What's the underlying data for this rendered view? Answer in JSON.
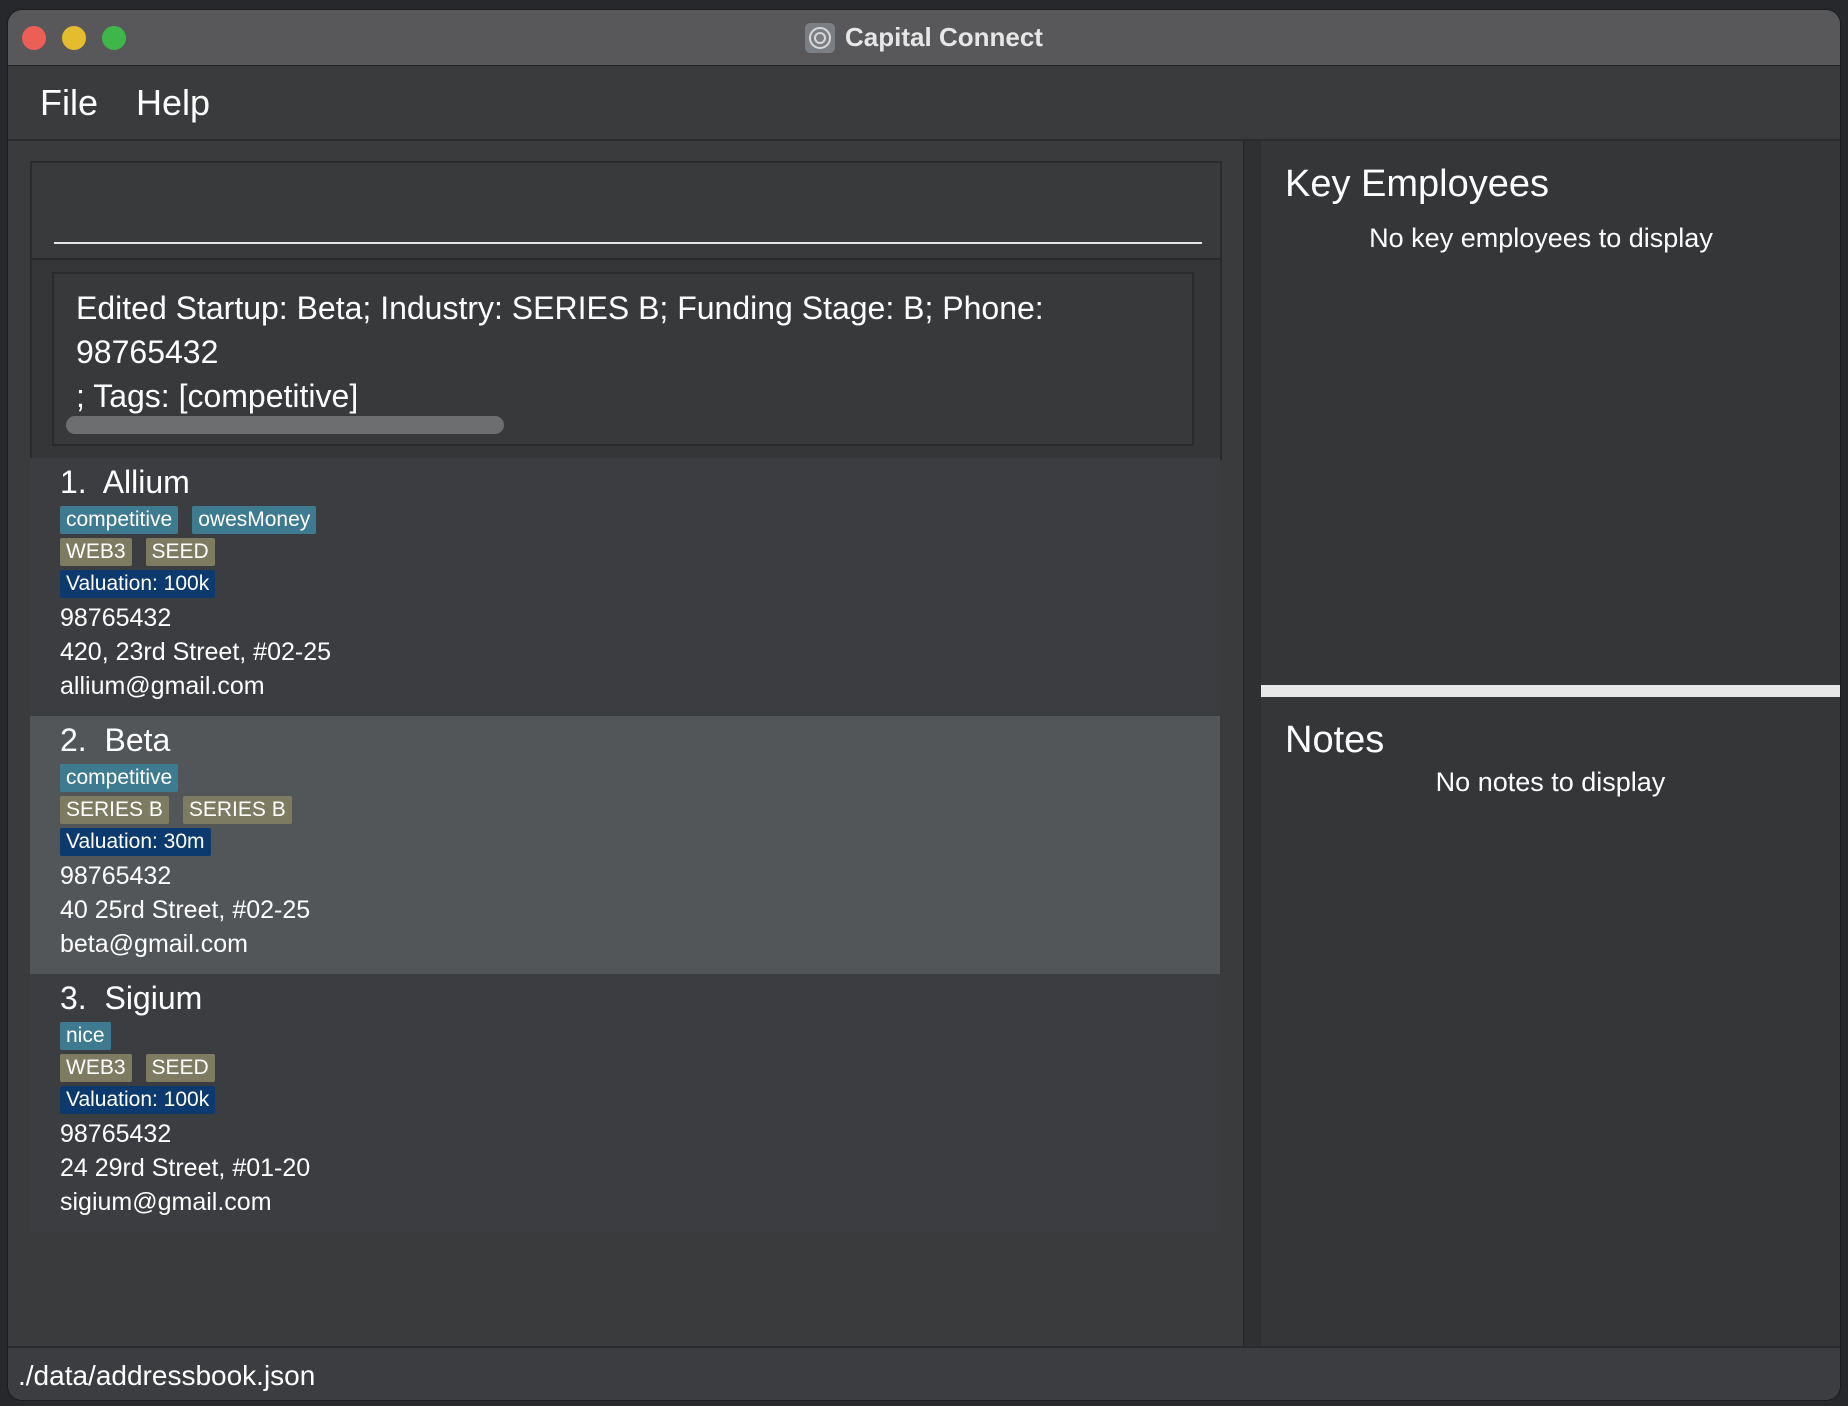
{
  "window": {
    "title": "Capital Connect"
  },
  "menu": {
    "file": "File",
    "help": "Help"
  },
  "command": {
    "value": ""
  },
  "result": {
    "line1": "Edited Startup: Beta; Industry: SERIES B; Funding Stage: B; Phone: 98765432",
    "line2": "; Tags: [competitive]"
  },
  "startups": [
    {
      "index": "1.",
      "name": "Allium",
      "tags": [
        "competitive",
        "owesMoney"
      ],
      "industry": "WEB3",
      "funding": "SEED",
      "valuation": "Valuation: 100k",
      "phone": "98765432",
      "address": "420, 23rd Street, #02-25",
      "email": "allium@gmail.com"
    },
    {
      "index": "2.",
      "name": "Beta",
      "tags": [
        "competitive"
      ],
      "industry": "SERIES B",
      "funding": "SERIES B",
      "valuation": "Valuation: 30m",
      "phone": "98765432",
      "address": "40 25rd Street, #02-25",
      "email": "beta@gmail.com"
    },
    {
      "index": "3.",
      "name": "Sigium",
      "tags": [
        "nice"
      ],
      "industry": "WEB3",
      "funding": "SEED",
      "valuation": "Valuation: 100k",
      "phone": "98765432",
      "address": "24 29rd Street, #01-20",
      "email": "sigium@gmail.com"
    }
  ],
  "keyEmployees": {
    "title": "Key Employees",
    "empty": "No key employees to display"
  },
  "notes": {
    "title": "Notes",
    "empty": "No notes to display"
  },
  "status": {
    "path": "./data/addressbook.json"
  },
  "colors": {
    "tag": "#3e7b91",
    "category": "#7d7c62",
    "valuation": "#0d3a6e",
    "selected": "#525659"
  }
}
